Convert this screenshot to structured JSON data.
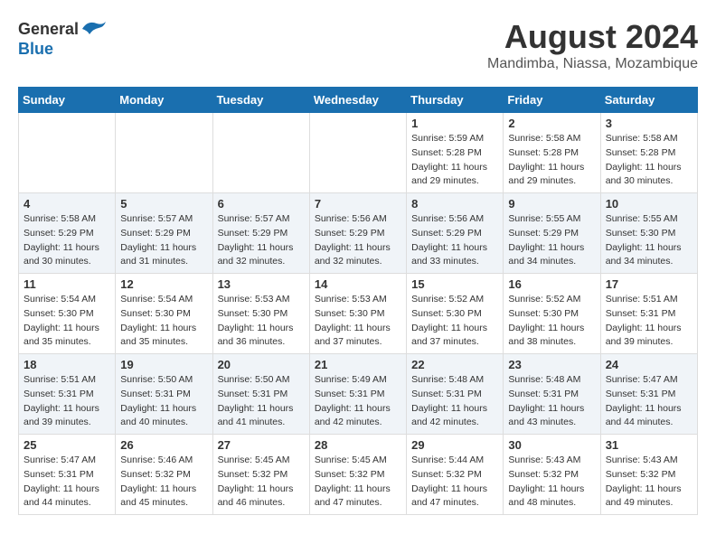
{
  "header": {
    "logo_general": "General",
    "logo_blue": "Blue",
    "month_year": "August 2024",
    "location": "Mandimba, Niassa, Mozambique"
  },
  "calendar": {
    "headers": [
      "Sunday",
      "Monday",
      "Tuesday",
      "Wednesday",
      "Thursday",
      "Friday",
      "Saturday"
    ],
    "weeks": [
      [
        {
          "day": "",
          "info": ""
        },
        {
          "day": "",
          "info": ""
        },
        {
          "day": "",
          "info": ""
        },
        {
          "day": "",
          "info": ""
        },
        {
          "day": "1",
          "info": "Sunrise: 5:59 AM\nSunset: 5:28 PM\nDaylight: 11 hours\nand 29 minutes."
        },
        {
          "day": "2",
          "info": "Sunrise: 5:58 AM\nSunset: 5:28 PM\nDaylight: 11 hours\nand 29 minutes."
        },
        {
          "day": "3",
          "info": "Sunrise: 5:58 AM\nSunset: 5:28 PM\nDaylight: 11 hours\nand 30 minutes."
        }
      ],
      [
        {
          "day": "4",
          "info": "Sunrise: 5:58 AM\nSunset: 5:29 PM\nDaylight: 11 hours\nand 30 minutes."
        },
        {
          "day": "5",
          "info": "Sunrise: 5:57 AM\nSunset: 5:29 PM\nDaylight: 11 hours\nand 31 minutes."
        },
        {
          "day": "6",
          "info": "Sunrise: 5:57 AM\nSunset: 5:29 PM\nDaylight: 11 hours\nand 32 minutes."
        },
        {
          "day": "7",
          "info": "Sunrise: 5:56 AM\nSunset: 5:29 PM\nDaylight: 11 hours\nand 32 minutes."
        },
        {
          "day": "8",
          "info": "Sunrise: 5:56 AM\nSunset: 5:29 PM\nDaylight: 11 hours\nand 33 minutes."
        },
        {
          "day": "9",
          "info": "Sunrise: 5:55 AM\nSunset: 5:29 PM\nDaylight: 11 hours\nand 34 minutes."
        },
        {
          "day": "10",
          "info": "Sunrise: 5:55 AM\nSunset: 5:30 PM\nDaylight: 11 hours\nand 34 minutes."
        }
      ],
      [
        {
          "day": "11",
          "info": "Sunrise: 5:54 AM\nSunset: 5:30 PM\nDaylight: 11 hours\nand 35 minutes."
        },
        {
          "day": "12",
          "info": "Sunrise: 5:54 AM\nSunset: 5:30 PM\nDaylight: 11 hours\nand 35 minutes."
        },
        {
          "day": "13",
          "info": "Sunrise: 5:53 AM\nSunset: 5:30 PM\nDaylight: 11 hours\nand 36 minutes."
        },
        {
          "day": "14",
          "info": "Sunrise: 5:53 AM\nSunset: 5:30 PM\nDaylight: 11 hours\nand 37 minutes."
        },
        {
          "day": "15",
          "info": "Sunrise: 5:52 AM\nSunset: 5:30 PM\nDaylight: 11 hours\nand 37 minutes."
        },
        {
          "day": "16",
          "info": "Sunrise: 5:52 AM\nSunset: 5:30 PM\nDaylight: 11 hours\nand 38 minutes."
        },
        {
          "day": "17",
          "info": "Sunrise: 5:51 AM\nSunset: 5:31 PM\nDaylight: 11 hours\nand 39 minutes."
        }
      ],
      [
        {
          "day": "18",
          "info": "Sunrise: 5:51 AM\nSunset: 5:31 PM\nDaylight: 11 hours\nand 39 minutes."
        },
        {
          "day": "19",
          "info": "Sunrise: 5:50 AM\nSunset: 5:31 PM\nDaylight: 11 hours\nand 40 minutes."
        },
        {
          "day": "20",
          "info": "Sunrise: 5:50 AM\nSunset: 5:31 PM\nDaylight: 11 hours\nand 41 minutes."
        },
        {
          "day": "21",
          "info": "Sunrise: 5:49 AM\nSunset: 5:31 PM\nDaylight: 11 hours\nand 42 minutes."
        },
        {
          "day": "22",
          "info": "Sunrise: 5:48 AM\nSunset: 5:31 PM\nDaylight: 11 hours\nand 42 minutes."
        },
        {
          "day": "23",
          "info": "Sunrise: 5:48 AM\nSunset: 5:31 PM\nDaylight: 11 hours\nand 43 minutes."
        },
        {
          "day": "24",
          "info": "Sunrise: 5:47 AM\nSunset: 5:31 PM\nDaylight: 11 hours\nand 44 minutes."
        }
      ],
      [
        {
          "day": "25",
          "info": "Sunrise: 5:47 AM\nSunset: 5:31 PM\nDaylight: 11 hours\nand 44 minutes."
        },
        {
          "day": "26",
          "info": "Sunrise: 5:46 AM\nSunset: 5:32 PM\nDaylight: 11 hours\nand 45 minutes."
        },
        {
          "day": "27",
          "info": "Sunrise: 5:45 AM\nSunset: 5:32 PM\nDaylight: 11 hours\nand 46 minutes."
        },
        {
          "day": "28",
          "info": "Sunrise: 5:45 AM\nSunset: 5:32 PM\nDaylight: 11 hours\nand 47 minutes."
        },
        {
          "day": "29",
          "info": "Sunrise: 5:44 AM\nSunset: 5:32 PM\nDaylight: 11 hours\nand 47 minutes."
        },
        {
          "day": "30",
          "info": "Sunrise: 5:43 AM\nSunset: 5:32 PM\nDaylight: 11 hours\nand 48 minutes."
        },
        {
          "day": "31",
          "info": "Sunrise: 5:43 AM\nSunset: 5:32 PM\nDaylight: 11 hours\nand 49 minutes."
        }
      ]
    ]
  }
}
